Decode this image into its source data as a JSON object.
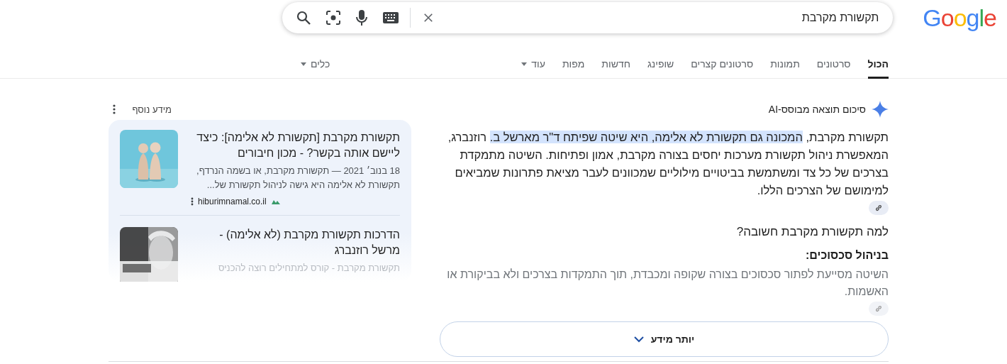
{
  "logo": "Google",
  "search": {
    "value": "תקשורת מקרבת"
  },
  "tabs": [
    {
      "label": "הכול",
      "selected": true,
      "kind": "tab"
    },
    {
      "label": "סרטונים",
      "selected": false,
      "kind": "tab"
    },
    {
      "label": "תמונות",
      "selected": false,
      "kind": "tab"
    },
    {
      "label": "סרטונים קצרים",
      "selected": false,
      "kind": "tab"
    },
    {
      "label": "שופינג",
      "selected": false,
      "kind": "tab"
    },
    {
      "label": "חדשות",
      "selected": false,
      "kind": "tab"
    },
    {
      "label": "מפות",
      "selected": false,
      "kind": "tab"
    },
    {
      "label": "עוד",
      "selected": false,
      "kind": "menu"
    }
  ],
  "tools": {
    "label": "כלים"
  },
  "ai_overview": {
    "title": "סיכום תוצאה מבוסס-AI",
    "paragraph": [
      {
        "text": "תקשורת מקרבת, ",
        "highlighted": false
      },
      {
        "text": "המכונה גם תקשורת לא אלימה, היא שיטה שפיתח ד\"ר מארשל ב.",
        "highlighted": true
      },
      {
        "text": " רוזנברג, המאפשרת ניהול תקשורת מערכות יחסים בצורה מקרבת, אמון ופתיחות. השיטה מתמקדת בצרכים של כל צד ומשתמשת בביטויים מילוליים שמכוונים לעבר מציאת פתרונות שמביאים למימושם של הצרכים הללו.",
        "highlighted": false
      }
    ],
    "section_heading": "למה תקשורת מקרבת חשובה?",
    "subheading": "בניהול סכסוכים:",
    "sub_text": "השיטה מסייעת לפתור סכסוכים בצורה שקופה ומכבדת, תוך התמקדות בצרכים ולא בביקורת או האשמות.",
    "more_button": "יותר מידע"
  },
  "side_panel": {
    "title": "מידע נוסף",
    "results": [
      {
        "title": "תקשורת מקרבת [תקשורת לא אלימה]: כיצד ליישם אותה בקשר? - מכון חיבורים",
        "snippet": "18 בנוב׳ 2021 — תקשורת מקרבת, או בשמה הנרדף, תקשורת לא אלימה היא גישה לניהול תקשורת של...",
        "source": "hiburimnamal.co.il",
        "faded": false
      },
      {
        "title": "הדרכות תקשורת מקרבת (לא אלימה) - מרשל רוזנברג",
        "snippet": "תקשורת מקרבת - קורס למתחילים רוצה להכניס",
        "faded": true
      }
    ]
  }
}
